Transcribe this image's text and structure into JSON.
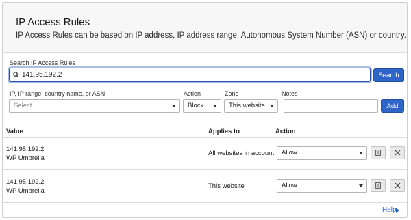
{
  "header": {
    "title": "IP Access Rules",
    "subtitle": "IP Access Rules can be based on IP address, IP address range, Autonomous System Number (ASN) or country."
  },
  "search": {
    "label": "Search IP Access Rules",
    "value": "141.95.192.2",
    "button_label": "Search"
  },
  "add_rule": {
    "target_label": "IP, IP range, country name, or ASN",
    "target_placeholder": "Select...",
    "action_label": "Action",
    "action_value": "Block",
    "zone_label": "Zone",
    "zone_value": "This website",
    "notes_label": "Notes",
    "notes_value": "",
    "add_button_label": "Add"
  },
  "table": {
    "columns": [
      "Value",
      "Applies to",
      "Action"
    ],
    "rows": [
      {
        "value": "141.95.192.2",
        "note": "WP Umbrella",
        "applies_to": "All websites in account",
        "action": "Allow"
      },
      {
        "value": "141.95.192.2",
        "note": "WP Umbrella",
        "applies_to": "This website",
        "action": "Allow"
      }
    ]
  },
  "footer": {
    "help_label": "Help"
  },
  "icons": [
    "search-icon",
    "chevron-down-icon",
    "edit-note-icon",
    "close-icon",
    "caret-right-icon"
  ],
  "colors": {
    "accent": "#2f64c9",
    "header_bg": "#f7f7f7",
    "border": "#cfcfcf"
  }
}
